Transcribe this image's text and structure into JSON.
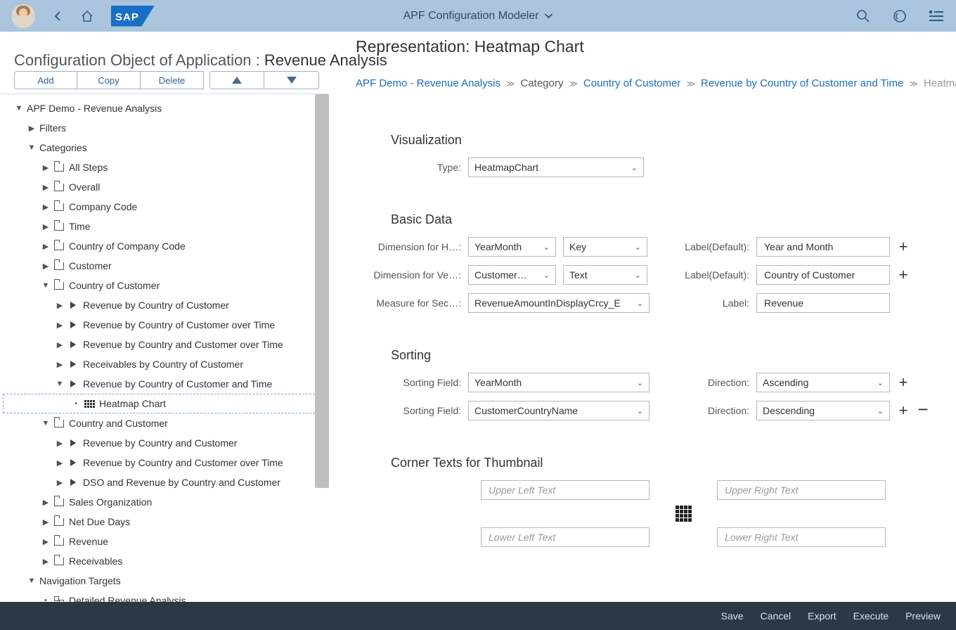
{
  "shell": {
    "title": "APF Configuration Modeler"
  },
  "page": {
    "prefix": "Configuration Object of Application :",
    "name": "Revenue Analysis"
  },
  "toolbar": {
    "add": "Add",
    "copy": "Copy",
    "delete": "Delete"
  },
  "tree": {
    "root": "APF Demo - Revenue Analysis",
    "filters": "Filters",
    "categories": "Categories",
    "cat_items": {
      "all_steps": "All Steps",
      "overall": "Overall",
      "company_code": "Company Code",
      "time": "Time",
      "country_company_code": "Country of Company Code",
      "customer": "Customer",
      "country_customer": "Country of Customer",
      "country_and_customer": "Country and Customer",
      "sales_org": "Sales Organization",
      "net_due_days": "Net Due Days",
      "revenue": "Revenue",
      "receivables": "Receivables"
    },
    "steps_coc": {
      "s1": "Revenue by Country of Customer",
      "s2": "Revenue by Country of Customer over Time",
      "s3": "Revenue by Country and Customer over Time",
      "s4": "Receivables by Country of Customer",
      "s5": "Revenue by Country of Customer and Time"
    },
    "rep": "Heatmap Chart",
    "steps_cac": {
      "s1": "Revenue by Country and Customer",
      "s2": "Revenue by Country and Customer over Time",
      "s3": "DSO and Revenue by Country and Customer"
    },
    "nav_targets": "Navigation Targets",
    "nav1": "Detailed Revenue Analysis"
  },
  "breadcrumb": {
    "b1": "APF Demo - Revenue Analysis",
    "b2": "Category",
    "b3": "Country of Customer",
    "b4": "Revenue by Country of Customer and Time",
    "b5": "Heatmap Chart"
  },
  "detail": {
    "title": "Representation: Heatmap Chart",
    "visualization_section": "Visualization",
    "type_label": "Type:",
    "type_value": "HeatmapChart",
    "basic_data_section": "Basic Data",
    "dim_h_label": "Dimension for H…:",
    "dim_h_value": "YearMonth",
    "dim_h_fmt": "Key",
    "dim_h_label2_label": "Label(Default):",
    "dim_h_label2_value": "Year and Month",
    "dim_v_label": "Dimension for Ve…:",
    "dim_v_value": "Customer…",
    "dim_v_fmt": "Text",
    "dim_v_label2_label": "Label(Default):",
    "dim_v_label2_value": "Country of Customer",
    "measure_label": "Measure for Sec…:",
    "measure_value": "RevenueAmountInDisplayCrcy_E",
    "measure_label2_label": "Label:",
    "measure_label2_value": "Revenue",
    "sorting_section": "Sorting",
    "sort_field_label": "Sorting Field:",
    "sort1_value": "YearMonth",
    "sort2_value": "CustomerCountryName",
    "direction_label": "Direction:",
    "dir1_value": "Ascending",
    "dir2_value": "Descending",
    "corner_section": "Corner Texts for Thumbnail",
    "corner_ul": "Upper Left Text",
    "corner_ur": "Upper Right Text",
    "corner_ll": "Lower Left Text",
    "corner_lr": "Lower Right Text"
  },
  "footer": {
    "save": "Save",
    "cancel": "Cancel",
    "export": "Export",
    "execute": "Execute",
    "preview": "Preview"
  }
}
